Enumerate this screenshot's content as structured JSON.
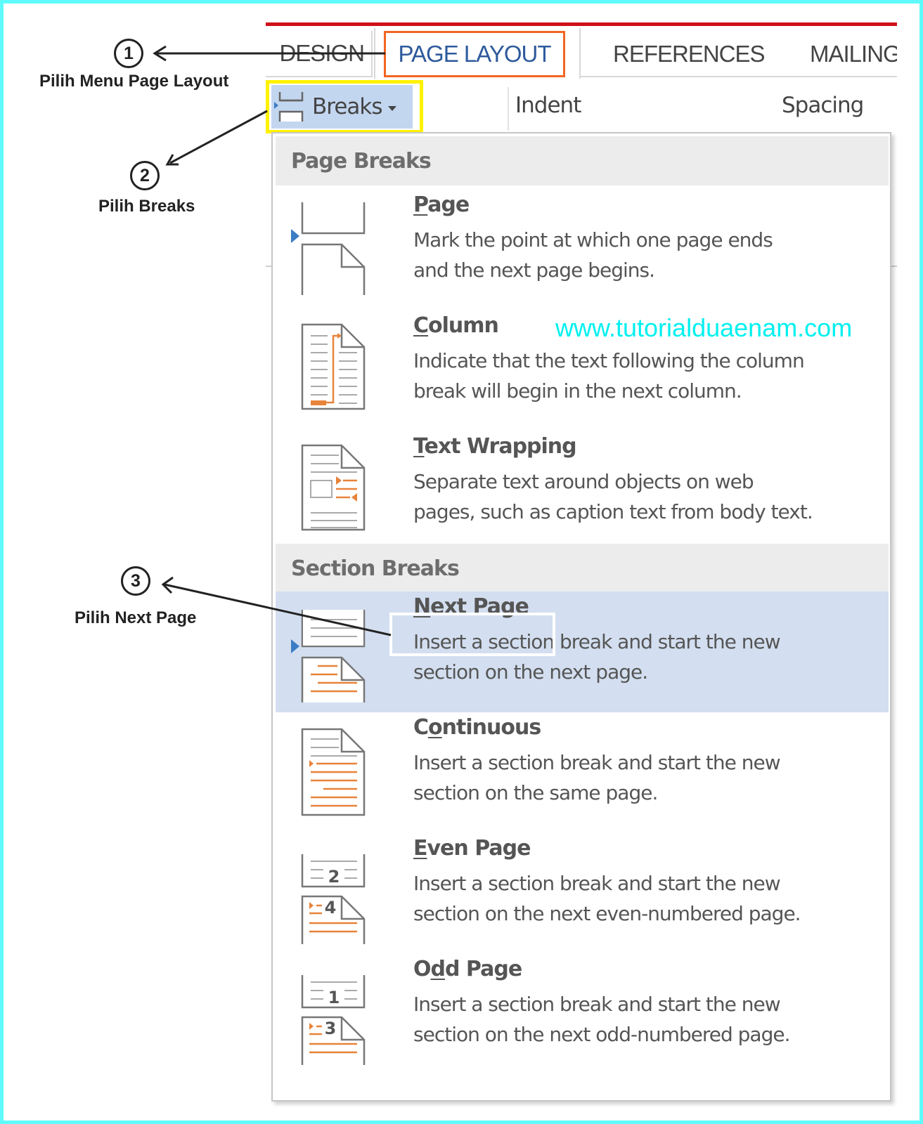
{
  "ribbon": {
    "tabs": [
      {
        "label": "DESIGN",
        "active": false
      },
      {
        "label": "PAGE LAYOUT",
        "active": true
      },
      {
        "label": "REFERENCES",
        "active": false
      },
      {
        "label": "MAILINGS",
        "active": false
      }
    ],
    "breaks_button": {
      "label": "Breaks",
      "icon": "breaks-icon"
    },
    "indent_label": "Indent",
    "spacing_label": "Spacing"
  },
  "menu": {
    "sections": [
      {
        "header": "Page Breaks",
        "items": [
          {
            "title_prefix": "",
            "title_mnemonic": "P",
            "title_suffix": "age",
            "title": "Page",
            "desc_lines": [
              "Mark the point at which one page ends",
              "and the next page begins."
            ],
            "icon": "page-break-icon",
            "selected": false
          },
          {
            "title_prefix": "",
            "title_mnemonic": "C",
            "title_suffix": "olumn",
            "title": "Column",
            "desc_lines": [
              "Indicate that the text following the column",
              "break will begin in the next column."
            ],
            "icon": "column-break-icon",
            "selected": false
          },
          {
            "title_prefix": "",
            "title_mnemonic": "T",
            "title_suffix": "ext Wrapping",
            "title": "Text Wrapping",
            "desc_lines": [
              "Separate text around objects on web",
              "pages, such as caption text from body text."
            ],
            "icon": "text-wrapping-break-icon",
            "selected": false
          }
        ]
      },
      {
        "header": "Section Breaks",
        "items": [
          {
            "title_prefix": "",
            "title_mnemonic": "N",
            "title_suffix": "ext Page",
            "title": "Next Page",
            "desc_lines": [
              "Insert a section break and start the new",
              "section on the next page."
            ],
            "icon": "next-page-break-icon",
            "selected": true
          },
          {
            "title_prefix": "C",
            "title_mnemonic": "o",
            "title_suffix": "ntinuous",
            "title": "Continuous",
            "desc_lines": [
              "Insert a section break and start the new",
              "section on the same page."
            ],
            "icon": "continuous-break-icon",
            "selected": false
          },
          {
            "title_prefix": "",
            "title_mnemonic": "E",
            "title_suffix": "ven Page",
            "title": "Even Page",
            "desc_lines": [
              "Insert a section break and start the new",
              "section on the next even-numbered page."
            ],
            "icon": "even-page-break-icon",
            "selected": false
          },
          {
            "title_prefix": "O",
            "title_mnemonic": "d",
            "title_suffix": "d Page",
            "title": "Odd Page",
            "desc_lines": [
              "Insert a section break and start the new",
              "section on the next odd-numbered page."
            ],
            "icon": "odd-page-break-icon",
            "selected": false
          }
        ]
      }
    ]
  },
  "icon_numbers": {
    "even_top": "2",
    "even_bottom": "4",
    "odd_top": "1",
    "odd_bottom": "3"
  },
  "annotations": [
    {
      "number": "1",
      "label": "Pilih Menu Page Layout"
    },
    {
      "number": "2",
      "label": "Pilih Breaks"
    },
    {
      "number": "3",
      "label": "Pilih Next Page"
    }
  ],
  "watermark": "www.tutorialduaenam.com",
  "colors": {
    "frame_border": "#5ffbfb",
    "ribbon_accent_red": "#d0101a",
    "active_tab_text": "#2e5a9c",
    "active_tab_highlight": "#f26522",
    "breaks_highlight": "#fff200",
    "breaks_button_bg": "#c3d6f0",
    "selected_item_bg": "#d3dff0",
    "icon_orange": "#e8833a",
    "watermark": "#00f0f0"
  }
}
